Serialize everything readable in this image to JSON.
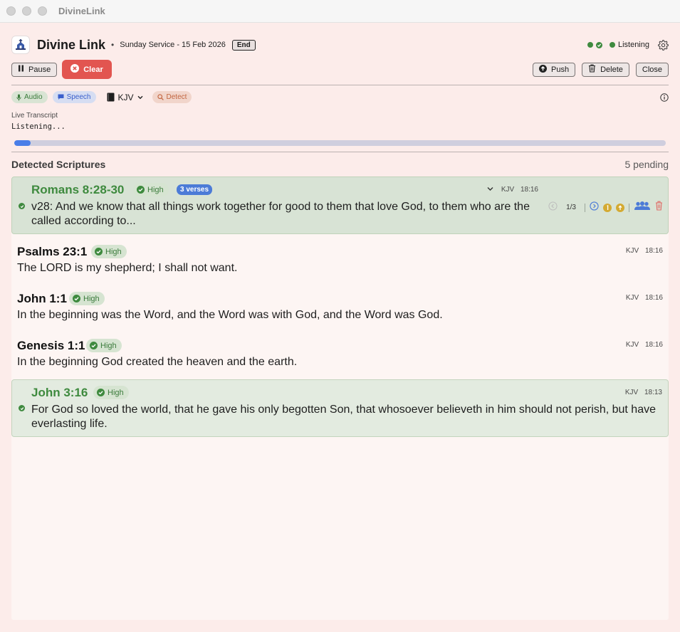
{
  "window": {
    "title": "DivineLink"
  },
  "header": {
    "app_name": "Divine Link",
    "separator": "•",
    "session": "Sunday Service - 15 Feb 2026",
    "end_label": "End",
    "status_label": "Listening"
  },
  "toolbar": {
    "pause_label": "Pause",
    "clear_label": "Clear",
    "push_label": "Push",
    "delete_label": "Delete",
    "close_label": "Close"
  },
  "chips": {
    "audio": "Audio",
    "speech": "Speech",
    "translation": "KJV",
    "detect": "Detect"
  },
  "transcript": {
    "label": "Live Transcript",
    "text": "Listening...",
    "progress": 0.025
  },
  "scriptures": {
    "title": "Detected Scriptures",
    "pending": "5 pending",
    "items": [
      {
        "reference": "Romans 8:28-30",
        "confidence": "High",
        "verses_badge": "3 verses",
        "translation": "KJV",
        "time": "18:16",
        "text": "v28: And we know that all things work together for good to them that love God, to them who are the called according to...",
        "counter": "1/3",
        "state": "active"
      },
      {
        "reference": "Psalms 23:1",
        "confidence": "High",
        "translation": "KJV",
        "time": "18:16",
        "text": "The LORD is my shepherd; I shall not want.",
        "state": "pending"
      },
      {
        "reference": "John 1:1",
        "confidence": "High",
        "translation": "KJV",
        "time": "18:16",
        "text": "In the beginning was the Word, and the Word was with God, and the Word was God.",
        "state": "pending"
      },
      {
        "reference": "Genesis 1:1",
        "confidence": "High",
        "translation": "KJV",
        "time": "18:16",
        "text": "In the beginning God created the heaven and the earth.",
        "state": "pending"
      },
      {
        "reference": "John 3:16",
        "confidence": "High",
        "translation": "KJV",
        "time": "18:13",
        "text": "For God so loved the world, that he gave his only begotten Son, that whosoever believeth in him should not perish, but have everlasting life.",
        "state": "pushed"
      }
    ]
  },
  "colors": {
    "accent_green": "#3e8a3e",
    "clear_red": "#e25550",
    "progress_blue": "#4a7ee8",
    "verses_blue": "#4c7bd7",
    "background": "#fcecea"
  },
  "icons": {
    "logo": "church-logo-icon",
    "settings": "gear-icon",
    "info": "info-icon",
    "pause": "pause-icon",
    "clear": "close-circle-icon",
    "push": "arrow-up-circle-icon",
    "delete": "trash-icon",
    "bible": "book-icon",
    "people": "people-icon"
  }
}
